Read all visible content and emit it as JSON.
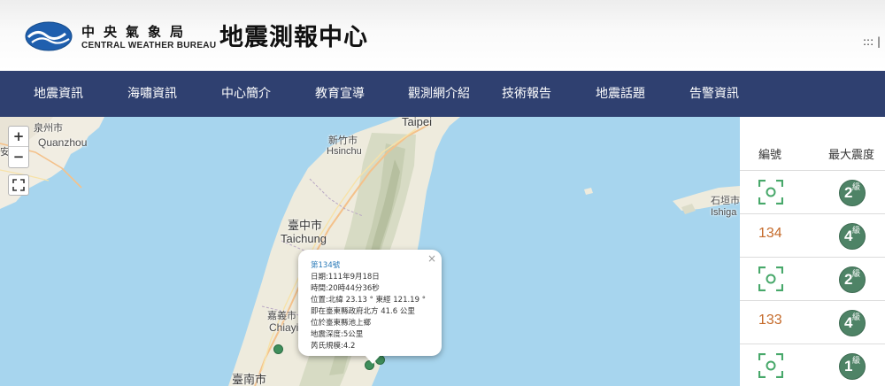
{
  "header": {
    "org_zh": "中央氣象局",
    "org_en": "CENTRAL WEATHER BUREAU",
    "site_title": "地震測報中心",
    "util_text": ":::  |"
  },
  "nav": {
    "items": [
      {
        "label": "地震資訊"
      },
      {
        "label": "海嘯資訊"
      },
      {
        "label": "中心簡介"
      },
      {
        "label": "教育宣導"
      },
      {
        "label": "觀測網介紹"
      },
      {
        "label": "技術報告"
      },
      {
        "label": "地震話題"
      },
      {
        "label": "告警資訊"
      }
    ]
  },
  "map": {
    "zoom_in": "+",
    "zoom_out": "−",
    "labels": {
      "quanzhou_zh": "泉州市",
      "quanzhou_en": "Quanzhou",
      "an_zh": "安",
      "taipei_en": "Taipei",
      "hsinchu_zh": "新竹市",
      "hsinchu_en": "Hsinchu",
      "taichung_zh": "臺中市",
      "taichung_en": "Taichung",
      "chiayi_zh": "嘉義市",
      "chiayi_en": "Chiayi",
      "tainan_zh": "臺南市",
      "ishigaki_zh": "石垣市",
      "ishigaki_en": "Ishiga"
    },
    "popup": {
      "close": "×",
      "title": "第134號",
      "lines": [
        "日期:111年9月18日",
        "時間:20時44分36秒",
        "位置:北緯 23.13 ° 東經 121.19 °",
        "即在臺東縣政府北方 41.6 公里",
        "位於臺東縣池上鄉",
        "地震深度:5公里",
        "芮氏規模:4.2"
      ]
    }
  },
  "table": {
    "col_number": "編號",
    "col_intensity": "最大震度",
    "intensity_unit": "級",
    "rows": [
      {
        "number": "",
        "intensity": "2"
      },
      {
        "number": "134",
        "intensity": "4"
      },
      {
        "number": "",
        "intensity": "2"
      },
      {
        "number": "133",
        "intensity": "4"
      },
      {
        "number": "",
        "intensity": "1"
      }
    ]
  },
  "colors": {
    "nav_bg": "#2f4070",
    "sea": "#a7d5ee",
    "badge": "#4e8366",
    "report_number": "#c56b2b",
    "scan_icon": "#47a86a"
  }
}
